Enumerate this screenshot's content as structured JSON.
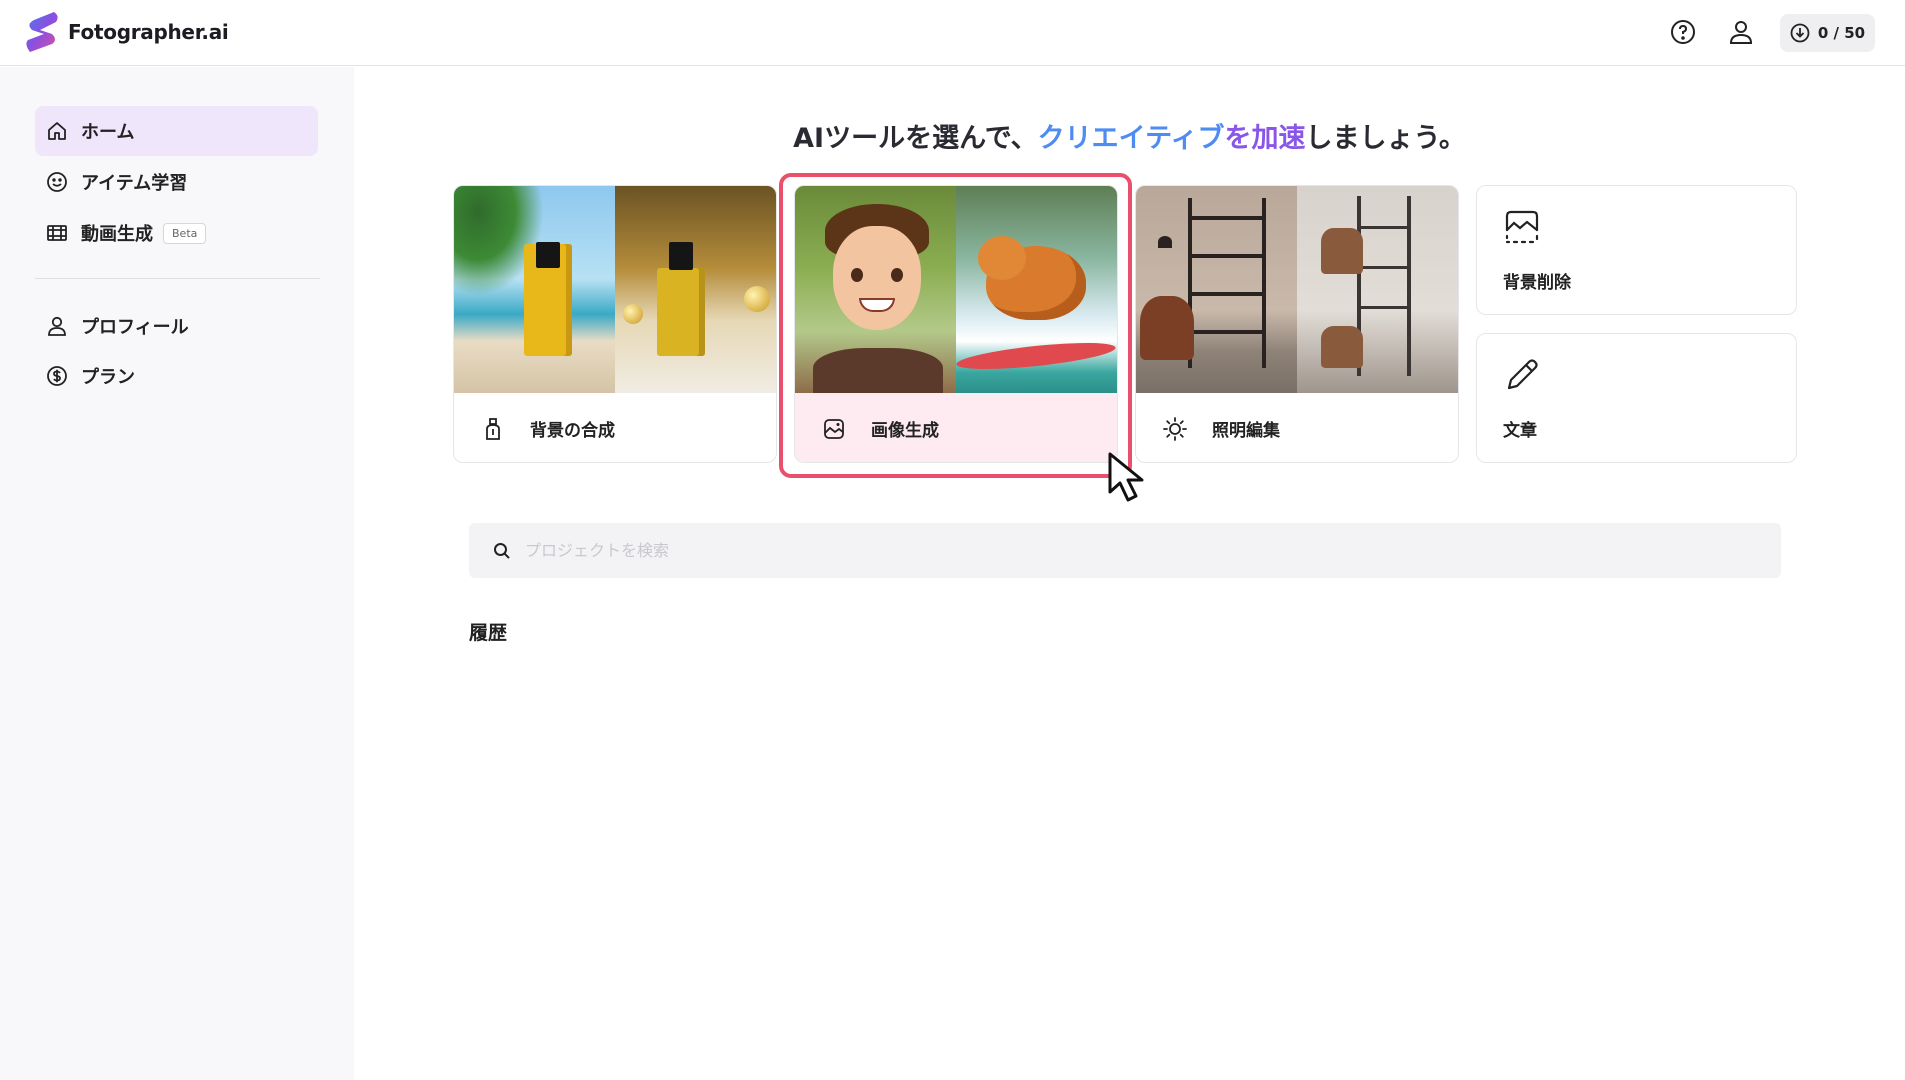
{
  "app": {
    "logo_text": "Fotographer.ai",
    "credits": "0 / 50",
    "header_icons": [
      "help-circle-icon",
      "user-icon",
      "download-circle-icon"
    ]
  },
  "sidebar": {
    "items": [
      {
        "label": "ホーム",
        "icon": "home-icon",
        "active": true
      },
      {
        "label": "アイテム学習",
        "icon": "smiley-icon"
      },
      {
        "label": "動画生成",
        "icon": "film-icon",
        "badge": "Beta"
      },
      {
        "label": "プロフィール",
        "icon": "user-icon"
      },
      {
        "label": "プラン",
        "icon": "dollar-circle-icon"
      }
    ]
  },
  "main": {
    "headline": {
      "part_a": "AIツールを選んで、",
      "part_b": "クリエイティブ",
      "part_c": "を加速",
      "part_d": "しましょう。"
    },
    "tools": [
      {
        "label": "背景の合成",
        "icon": "perfume-bottle-icon"
      },
      {
        "label": "画像生成",
        "icon": "image-sparkle-icon",
        "selected": true
      },
      {
        "label": "照明編集",
        "icon": "sun-icon"
      },
      {
        "label": "背景削除",
        "icon": "image-dashed-icon"
      },
      {
        "label": "文章",
        "icon": "pencil-icon"
      }
    ],
    "search": {
      "placeholder": "プロジェクトを検索"
    },
    "history_title": "履歴"
  },
  "colors": {
    "accent_purple": "#8a56e8",
    "accent_blue": "#4f8cf2",
    "selection_red": "#e8506c",
    "sidebar_active": "#efe6fb"
  }
}
